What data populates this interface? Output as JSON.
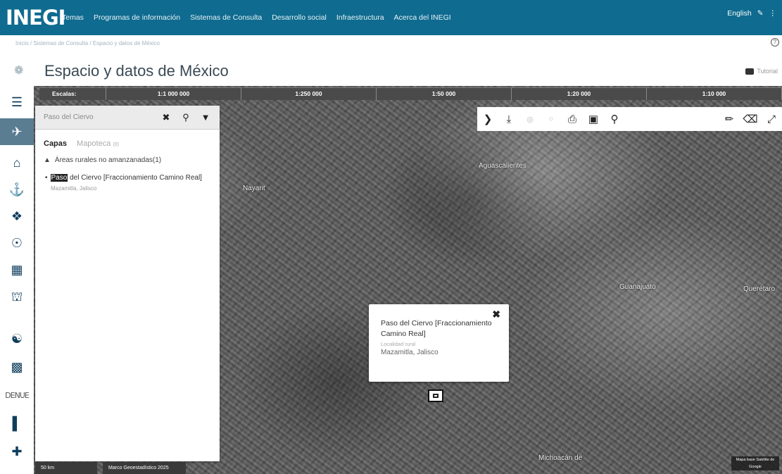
{
  "header": {
    "logo": "INEGI",
    "nav": [
      "Temas",
      "Programas de información",
      "Sistemas de Consulta",
      "Desarrollo social",
      "Infraestructura",
      "Acerca del INEGI"
    ],
    "language": "English"
  },
  "breadcrumb": "Inicio / Sistemas de Consulta / Espacio y datos de México",
  "page": {
    "title": "Espacio y datos de México",
    "tutorial": "Tutorial"
  },
  "scales": {
    "label": "Escalas:",
    "values": [
      "1:1 000 000",
      "1:250 000",
      "1:50 000",
      "1:20 000",
      "1:10 000"
    ]
  },
  "search": {
    "value": "Paso del Ciervo"
  },
  "panel": {
    "tabs": {
      "capas": "Capas",
      "mapoteca": "Mapoteca",
      "mapoteca_badge": "(0)"
    },
    "group": "Áreas rurales no amanzanadas(1)",
    "result_highlight": "Paso",
    "result_rest": "del Ciervo [Fraccionamiento Camino Real]",
    "result_sub": "Mazamitla, Jalisco"
  },
  "map_labels": {
    "nayarit": "Nayarit",
    "aguascalientes": "Aguascalientes",
    "guanajuato": "Guanajuato",
    "queretaro": "Querétaro",
    "michoacan": "Michoacán de"
  },
  "popup": {
    "title": "Paso del Ciervo [Fraccionamiento Camino Real]",
    "type": "Localidad rural",
    "place": "Mazamitla, Jalisco"
  },
  "footer": {
    "scale": "50 km",
    "copyright": "Marco Geoestadístico 2025",
    "attribution": "Mapa base Satélite de Google"
  },
  "sidebar_text": "DENUE"
}
